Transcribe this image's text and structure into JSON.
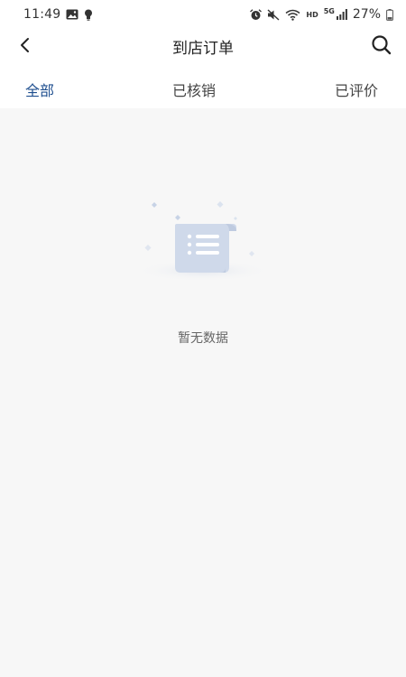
{
  "status_bar": {
    "time": "11:49",
    "left_icons": [
      "image-icon",
      "bulb-icon"
    ],
    "right_icons": [
      "alarm-icon",
      "mute-icon",
      "wifi-icon",
      "hd-label",
      "5g-signal-icon",
      "battery-icon"
    ],
    "hd_label": "HD",
    "network_label": "5G",
    "battery_text": "27%"
  },
  "header": {
    "title": "到店订单",
    "back_icon": "chevron-left-icon",
    "search_icon": "search-icon"
  },
  "tabs": [
    {
      "label": "全部",
      "active": true
    },
    {
      "label": "已核销",
      "active": false
    },
    {
      "label": "已评价",
      "active": false
    }
  ],
  "empty_state": {
    "illustration": "empty-document-icon",
    "message": "暂无数据"
  },
  "colors": {
    "accent": "#1f4f8f",
    "background": "#f7f7f7",
    "surface": "#ffffff",
    "illustration": "#cfd9ea"
  }
}
